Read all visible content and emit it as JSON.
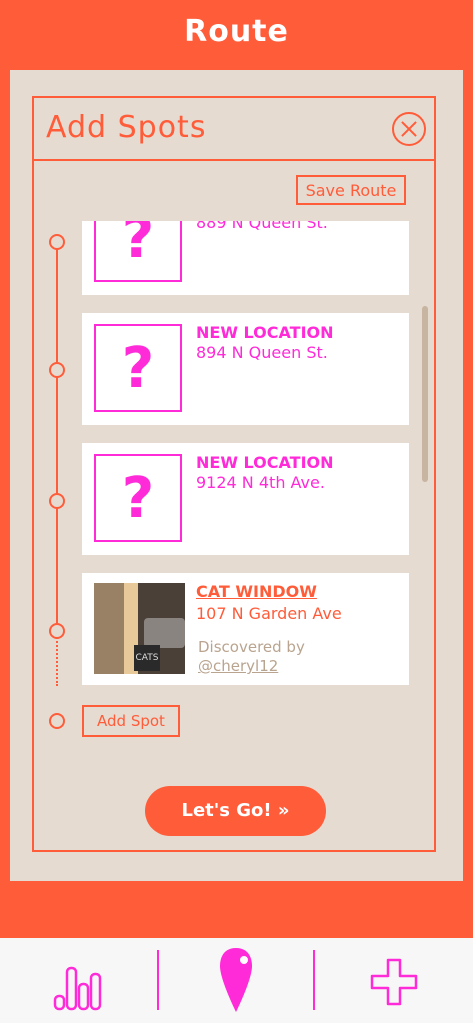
{
  "header": {
    "title": "Route"
  },
  "dialog": {
    "title": "Add Spots",
    "save_label": "Save Route",
    "add_spot_label": "Add Spot",
    "go_label": "Let's Go! »"
  },
  "spots": [
    {
      "name": "",
      "address": "889 N Queen St.",
      "thumb": "?"
    },
    {
      "name": "NEW LOCATION",
      "address": "894 N Queen St.",
      "thumb": "?"
    },
    {
      "name": "NEW LOCATION",
      "address": "9124 N 4th Ave.",
      "thumb": "?"
    },
    {
      "name": "CAT WINDOW",
      "address": "107 N Garden Ave",
      "discovered_label": "Discovered by",
      "discovered_user": "@cheryl12",
      "photo_text": "CATS"
    }
  ],
  "nav": {
    "items": [
      {
        "icon": "stats-bars-icon"
      },
      {
        "icon": "location-pin-icon",
        "active": true
      },
      {
        "icon": "plus-icon"
      }
    ]
  },
  "colors": {
    "primary": "#ff5c3a",
    "accent": "#ff2ad8",
    "panel": "#e6dbd0",
    "muted": "#b9a48f"
  }
}
